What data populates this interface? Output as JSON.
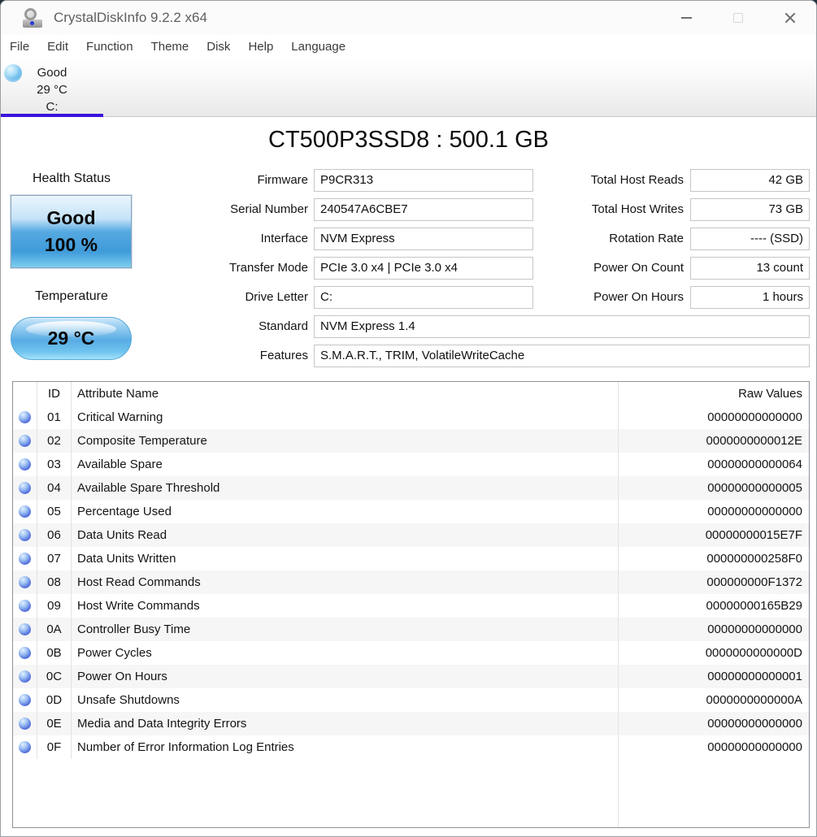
{
  "window": {
    "title": "CrystalDiskInfo 9.2.2 x64"
  },
  "menu": {
    "items": [
      "File",
      "Edit",
      "Function",
      "Theme",
      "Disk",
      "Help",
      "Language"
    ]
  },
  "drive_tab": {
    "status": "Good",
    "temperature": "29 °C",
    "letter": "C:"
  },
  "drive": {
    "title": "CT500P3SSD8 : 500.1 GB",
    "health": {
      "label": "Health Status",
      "status": "Good",
      "percent": "100 %"
    },
    "temperature": {
      "label": "Temperature",
      "value": "29 °C"
    },
    "fields_left": [
      {
        "label": "Firmware",
        "value": "P9CR313"
      },
      {
        "label": "Serial Number",
        "value": "240547A6CBE7"
      },
      {
        "label": "Interface",
        "value": "NVM Express"
      },
      {
        "label": "Transfer Mode",
        "value": "PCIe 3.0 x4 | PCIe 3.0 x4"
      },
      {
        "label": "Drive Letter",
        "value": "C:"
      },
      {
        "label": "Standard",
        "value": "NVM Express 1.4"
      },
      {
        "label": "Features",
        "value": "S.M.A.R.T., TRIM, VolatileWriteCache"
      }
    ],
    "fields_right": [
      {
        "label": "Total Host Reads",
        "value": "42 GB"
      },
      {
        "label": "Total Host Writes",
        "value": "73 GB"
      },
      {
        "label": "Rotation Rate",
        "value": "---- (SSD)"
      },
      {
        "label": "Power On Count",
        "value": "13 count"
      },
      {
        "label": "Power On Hours",
        "value": "1 hours"
      }
    ]
  },
  "smart": {
    "columns": {
      "id": "ID",
      "name": "Attribute Name",
      "raw": "Raw Values"
    },
    "rows": [
      {
        "id": "01",
        "name": "Critical Warning",
        "raw": "00000000000000"
      },
      {
        "id": "02",
        "name": "Composite Temperature",
        "raw": "0000000000012E"
      },
      {
        "id": "03",
        "name": "Available Spare",
        "raw": "00000000000064"
      },
      {
        "id": "04",
        "name": "Available Spare Threshold",
        "raw": "00000000000005"
      },
      {
        "id": "05",
        "name": "Percentage Used",
        "raw": "00000000000000"
      },
      {
        "id": "06",
        "name": "Data Units Read",
        "raw": "00000000015E7F"
      },
      {
        "id": "07",
        "name": "Data Units Written",
        "raw": "000000000258F0"
      },
      {
        "id": "08",
        "name": "Host Read Commands",
        "raw": "000000000F1372"
      },
      {
        "id": "09",
        "name": "Host Write Commands",
        "raw": "00000000165B29"
      },
      {
        "id": "0A",
        "name": "Controller Busy Time",
        "raw": "00000000000000"
      },
      {
        "id": "0B",
        "name": "Power Cycles",
        "raw": "0000000000000D"
      },
      {
        "id": "0C",
        "name": "Power On Hours",
        "raw": "00000000000001"
      },
      {
        "id": "0D",
        "name": "Unsafe Shutdowns",
        "raw": "0000000000000A"
      },
      {
        "id": "0E",
        "name": "Media and Data Integrity Errors",
        "raw": "00000000000000"
      },
      {
        "id": "0F",
        "name": "Number of Error Information Log Entries",
        "raw": "00000000000000"
      }
    ]
  },
  "colors": {
    "accent_tab_underline": "#3a12dd",
    "health_blue": "#4aa0dd",
    "orb_blue": "#4a5fd0",
    "table_border": "#8d939b"
  }
}
